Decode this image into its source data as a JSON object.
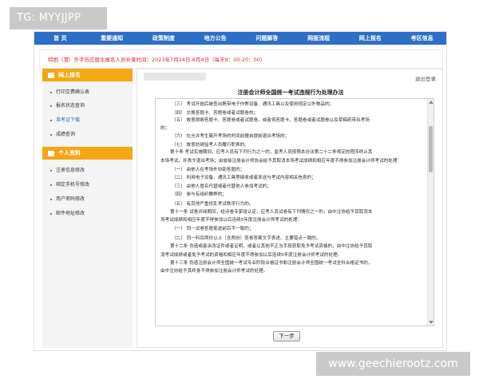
{
  "overlay": {
    "tg_label": "TG: MYYJJPP",
    "watermark": "www.geechierootz.com"
  },
  "nav": {
    "items": [
      "首 页",
      "重要通知",
      "政策制度",
      "地方公告",
      "问题解答",
      "网报流程",
      "网上报名",
      "考区信息"
    ]
  },
  "notice": {
    "text": "特困（港）外字历应届生报名人员补录时间：2023年7月24日-8月4日（每天9：00-20：00）"
  },
  "sidebar": {
    "section1": {
      "title": "网上报名",
      "items": [
        "打印交费确认表",
        "报名状态查询",
        "准考证下载",
        "成绩查询"
      ]
    },
    "section2": {
      "title": "个人资料",
      "items": [
        "注册信息修改",
        "绑定手机号修改",
        "用户密码修改",
        "邮件地址修改"
      ]
    }
  },
  "panel": {
    "logout": "退出登录",
    "doc_title": "注册会计师全国统一考试违规行为处理办法",
    "paragraphs": [
      "（三） 考试开始后被查出携带电子作弊设备、通讯工具以及使用规定以外物品的；",
      "（四） 交换答题卡、答题卷或者试题卷的；",
      "（五） 故意损毁答题卡、答题卷或者试题卷，或者将答题卡、答题卷或者试题卷以及草稿纸带出考场",
      "的；",
      "（六） 在允许考生离开考场的时间前擅自提前退出考场的；",
      "（七） 故意妨碍监考人员履行职责的。",
      "第十条 考试实施期间，应考人员有下列行为之一的，监考人员按照本办法第二十二条规定的程序终止其",
      "本场考试，并责令退出考场；由省级注册会计师协会给予其取消本场考试成绩和相应年度不得参加注册会计师考试的处理：",
      "（一） 由他人在考场外协助答题的；",
      "（二） 利用电子设备、通讯工具等接收或者发送与考试内容相关信息的；",
      "（三） 由他人冒名代替或者代替他人参加考试的；",
      "（四） 参与有组织舞弊的；",
      "（五） 有其他严重扰乱考试秩序行为的。",
      "第十一条 试卷评阅期间，经评卷专家组认定，应考人员试卷有下列情形之一的，由中注协给予其取消本",
      "场考试成绩和相应年度不得参加以后连续5年度注册会计师考试的处理：",
      "（一） 同一试卷答题笔迹前后不一致的；",
      "（二） 同一科目两份以上（含两份）答卷答案文字表述、主要错点一致的。",
      "第十二条 伪造或者涂改证件或者证明，或者以其他不正当手段获取免予考试资格的，由中注协给予其取",
      "消考试成绩或者免予考试的资格和相应年度不得参加以后连续5年度注册会计师考试的处理。",
      "第十三条 伪造注册会计师全国统一考试专业阶段合格证书和注册会计师全国统一考试全科合格证书的，",
      "由中注协给予其终身不得参加注册会计师考试的处理。"
    ],
    "next_button": "下一步"
  }
}
